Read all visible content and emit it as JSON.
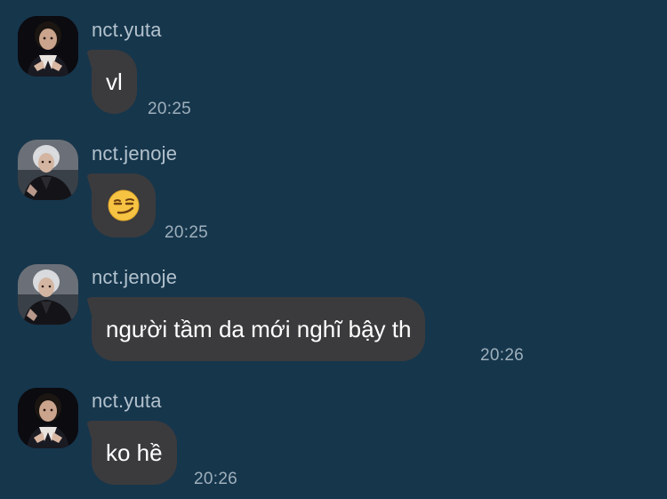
{
  "messages": [
    {
      "sender": "nct.yuta",
      "text": "vl",
      "time": "20:25",
      "avatar_icon": "profile-photo-yuta"
    },
    {
      "sender": "nct.jenoje",
      "text": "😏",
      "time": "20:25",
      "avatar_icon": "profile-photo-jenoje"
    },
    {
      "sender": "nct.jenoje",
      "text": "người tầm da mới nghĩ bậy th",
      "time": "20:26",
      "avatar_icon": "profile-photo-jenoje"
    },
    {
      "sender": "nct.yuta",
      "text": "ko hề",
      "time": "20:26",
      "avatar_icon": "profile-photo-yuta"
    }
  ],
  "colors": {
    "background": "#16364c",
    "bubble": "#3b3b3d",
    "sender_text": "#b3c2cd",
    "time_text": "#9fb0bc",
    "message_text": "#ffffff"
  }
}
